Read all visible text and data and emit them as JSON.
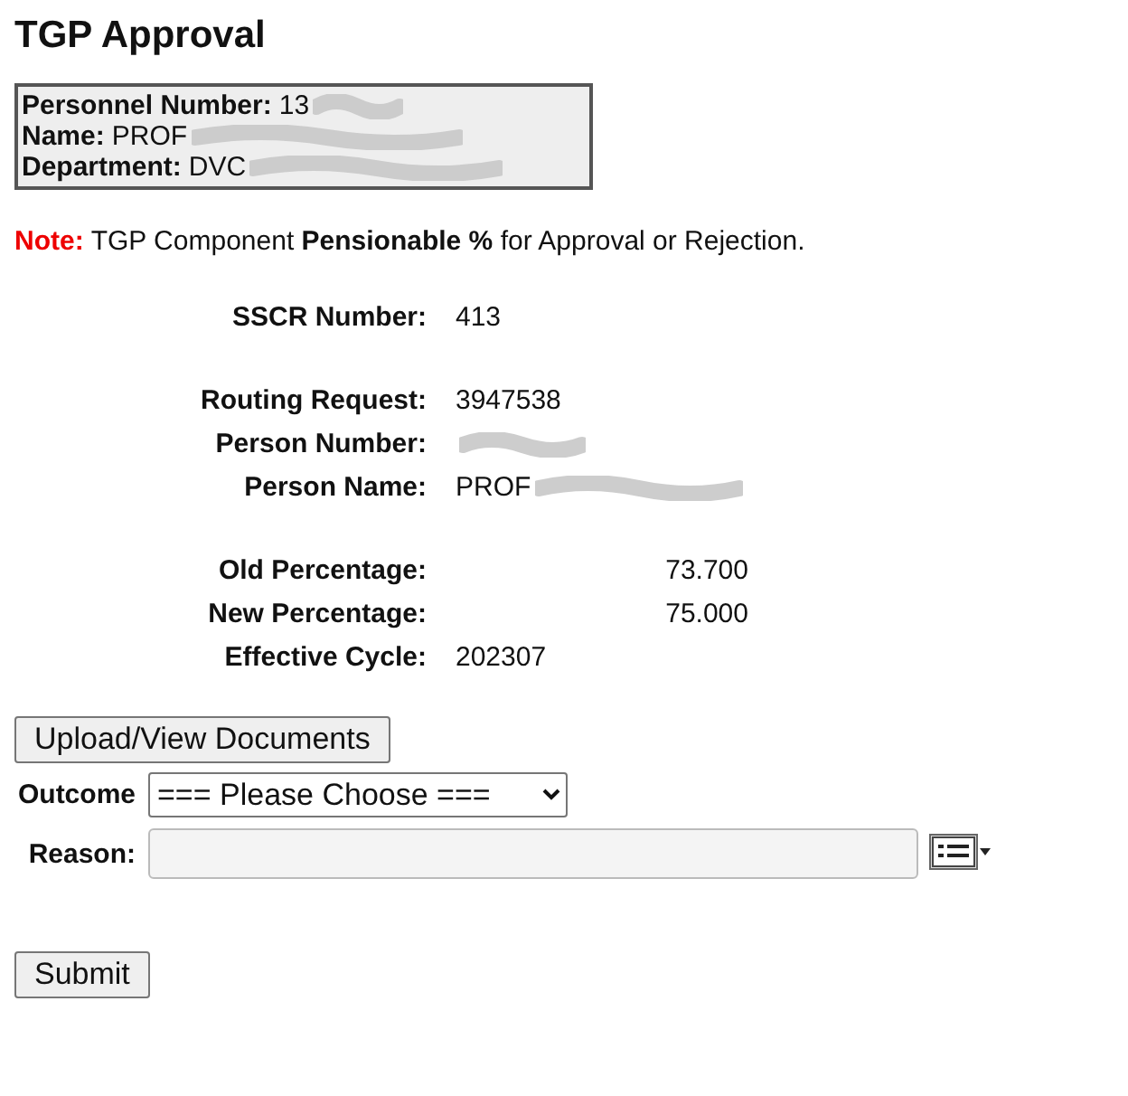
{
  "title": "TGP Approval",
  "personnel": [
    {
      "label": "Personnel Number:",
      "value": "13",
      "redacted": true
    },
    {
      "label": "Name:",
      "value": "PROF",
      "redacted": true
    },
    {
      "label": "Department:",
      "value": "DVC",
      "redacted": true
    }
  ],
  "note": {
    "label": "Note:",
    "text": "TGP Component **Pensionable %** for Approval or Rejection."
  },
  "field_groups": [
    [
      {
        "label": "SSCR Number:",
        "value": "413",
        "kind": "text",
        "redacted": false
      }
    ],
    [
      {
        "label": "Routing Request:",
        "value": "3947538",
        "kind": "text",
        "redacted": false
      },
      {
        "label": "Person Number:",
        "kind": "text",
        "redacted": true
      },
      {
        "label": "Person Name:",
        "value": "PROF",
        "kind": "text",
        "redacted": true
      }
    ],
    [
      {
        "label": "Old Percentage:",
        "value": "73.700",
        "kind": "numeric",
        "redacted": false
      },
      {
        "label": "New Percentage:",
        "value": "75.000",
        "kind": "numeric",
        "redacted": false
      },
      {
        "label": "Effective Cycle:",
        "value": "202307",
        "kind": "text",
        "redacted": false
      }
    ]
  ],
  "upload_button": "Upload/View Documents",
  "outcome": {
    "label": "Outcome",
    "value": "=== Please Choose ==="
  },
  "reason": {
    "label": "Reason:"
  },
  "submit_button": "Submit"
}
